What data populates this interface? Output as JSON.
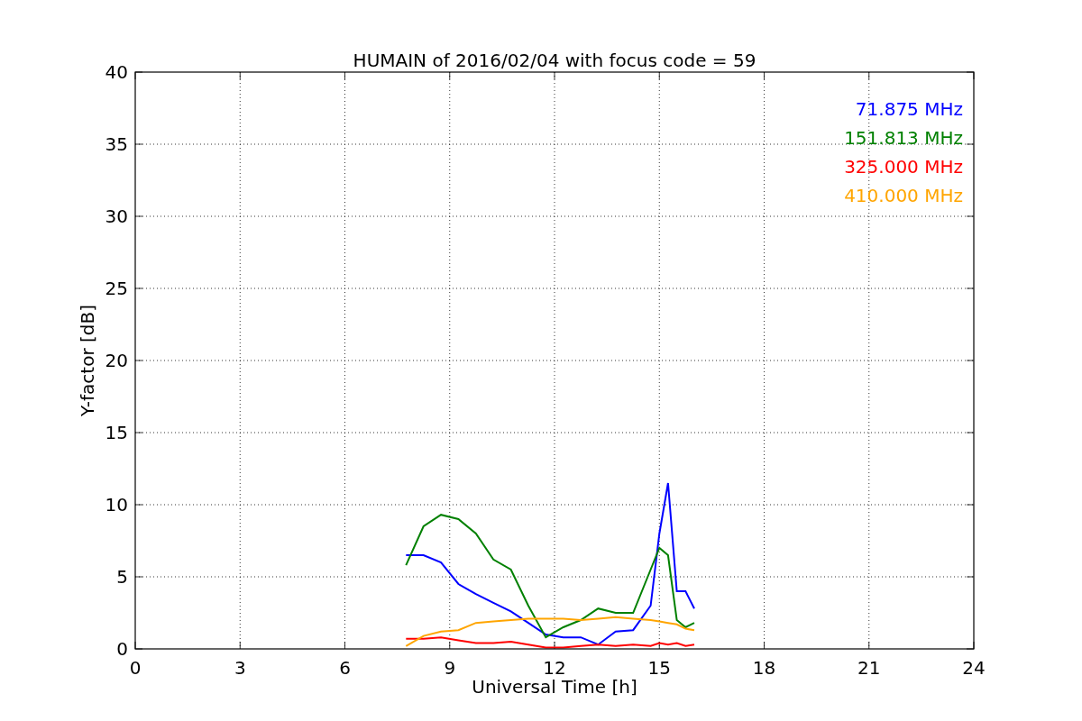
{
  "chart": {
    "chart_data": {
      "type": "line",
      "title": "HUMAIN of 2016/02/04 with focus code = 59",
      "xlabel": "Universal Time [h]",
      "ylabel": "Y-factor [dB]",
      "x": [
        7.75,
        8.25,
        8.75,
        9.25,
        9.75,
        10.25,
        10.75,
        11.25,
        11.75,
        12.25,
        12.75,
        13.25,
        13.75,
        14.25,
        14.75,
        15.0,
        15.25,
        15.5,
        15.75,
        16.0
      ],
      "series": [
        {
          "name": "71.875 MHz",
          "color": "#0000ff",
          "values": [
            6.5,
            6.5,
            6.0,
            4.5,
            3.8,
            3.2,
            2.6,
            1.8,
            1.0,
            0.8,
            0.8,
            0.3,
            1.2,
            1.3,
            3.0,
            8.0,
            11.5,
            4.0,
            4.0,
            2.8
          ]
        },
        {
          "name": "151.813 MHz",
          "color": "#008000",
          "values": [
            5.8,
            8.5,
            9.3,
            9.0,
            8.0,
            6.2,
            5.5,
            3.0,
            0.8,
            1.5,
            2.0,
            2.8,
            2.5,
            2.5,
            5.5,
            7.0,
            6.5,
            2.0,
            1.5,
            1.8
          ]
        },
        {
          "name": "325.000 MHz",
          "color": "#ff0000",
          "values": [
            0.7,
            0.7,
            0.8,
            0.6,
            0.4,
            0.4,
            0.5,
            0.3,
            0.1,
            0.1,
            0.2,
            0.3,
            0.2,
            0.3,
            0.2,
            0.4,
            0.3,
            0.4,
            0.2,
            0.3
          ]
        },
        {
          "name": "410.000 MHz",
          "color": "#ffa500",
          "values": [
            0.2,
            0.9,
            1.2,
            1.3,
            1.8,
            1.9,
            2.0,
            2.1,
            2.1,
            2.1,
            2.0,
            2.1,
            2.2,
            2.1,
            2.0,
            1.9,
            1.8,
            1.7,
            1.4,
            1.3
          ]
        }
      ],
      "xlim": [
        0,
        24
      ],
      "ylim": [
        0,
        40
      ],
      "xticks": [
        0,
        3,
        6,
        9,
        12,
        15,
        18,
        21,
        24
      ],
      "yticks": [
        0,
        5,
        10,
        15,
        20,
        25,
        30,
        35,
        40
      ],
      "grid": true
    }
  }
}
